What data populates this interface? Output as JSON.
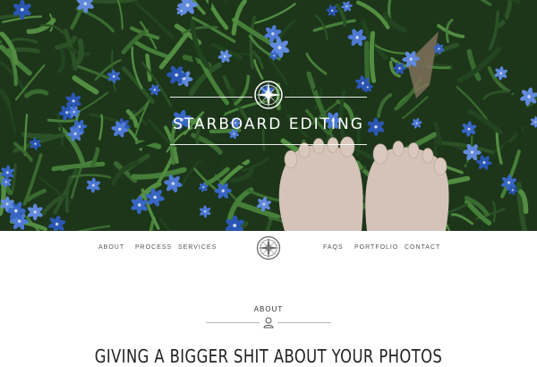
{
  "hero": {
    "brand_name": "STARBOARD EDITING",
    "logo_icon": "compass-rose-icon",
    "colors": {
      "grass": "#2f5a2a",
      "flower": "#3d6fd6",
      "skin": "#e8d3c8"
    }
  },
  "nav": {
    "left_items": [
      {
        "label": "ABOUT"
      },
      {
        "label": "PROCESS"
      },
      {
        "label": "SERVICES"
      }
    ],
    "logo_icon": "compass-rose-icon",
    "right_items": [
      {
        "label": "FAQS"
      },
      {
        "label": "PORTFOLIO"
      },
      {
        "label": "CONTACT"
      }
    ]
  },
  "about": {
    "section_label": "ABOUT",
    "divider_icon": "person-icon",
    "headline": "GIVING A BIGGER SHIT ABOUT YOUR PHOTOS"
  }
}
